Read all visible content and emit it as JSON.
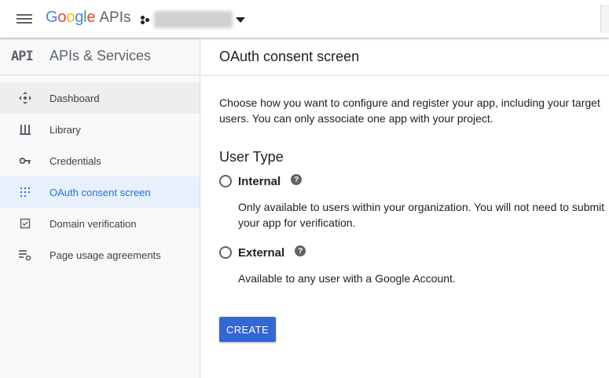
{
  "header": {
    "logo_letters": [
      {
        "char": "G",
        "color": "#4285F4"
      },
      {
        "char": "o",
        "color": "#EA4335"
      },
      {
        "char": "o",
        "color": "#FBBC05"
      },
      {
        "char": "g",
        "color": "#4285F4"
      },
      {
        "char": "l",
        "color": "#34A853"
      },
      {
        "char": "e",
        "color": "#EA4335"
      }
    ],
    "logo_suffix": "APIs",
    "menu_icon": "hamburger-menu-icon",
    "project_icon": "project-dots-icon"
  },
  "sidebar": {
    "icon_text": "API",
    "title": "APIs & Services",
    "items": [
      {
        "label": "Dashboard",
        "icon": "dashboard-icon",
        "state": "hover"
      },
      {
        "label": "Library",
        "icon": "library-icon",
        "state": ""
      },
      {
        "label": "Credentials",
        "icon": "key-icon",
        "state": ""
      },
      {
        "label": "OAuth consent screen",
        "icon": "consent-grid-icon",
        "state": "active"
      },
      {
        "label": "Domain verification",
        "icon": "checkbox-icon",
        "state": ""
      },
      {
        "label": "Page usage agreements",
        "icon": "list-settings-icon",
        "state": ""
      }
    ]
  },
  "main": {
    "title": "OAuth consent screen",
    "description": "Choose how you want to configure and register your app, including your target users. You can only associate one app with your project.",
    "section_title": "User Type",
    "options": [
      {
        "label": "Internal",
        "help": "?",
        "description": "Only available to users within your organization. You will not need to submit your app for verification."
      },
      {
        "label": "External",
        "help": "?",
        "description": "Available to any user with a Google Account."
      }
    ],
    "create_label": "CREATE"
  },
  "colors": {
    "accent": "#1a73e8",
    "button": "#3367d6",
    "active_bg": "#e8f0fe",
    "sidebar_bg": "#f8f9fa"
  }
}
